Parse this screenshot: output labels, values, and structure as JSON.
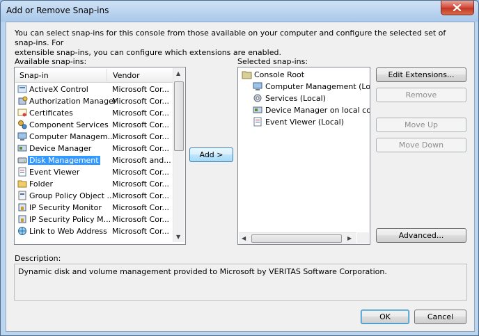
{
  "window": {
    "title": "Add or Remove Snap-ins"
  },
  "intro": {
    "line1": "You can select snap-ins for this console from those available on your computer and configure the selected set of snap-ins. For",
    "line2": "extensible snap-ins, you can configure which extensions are enabled."
  },
  "available": {
    "label": "Available snap-ins:",
    "col_snapin": "Snap-in",
    "col_vendor": "Vendor",
    "rows": [
      {
        "name": "ActiveX Control",
        "vendor": "Microsoft Cor...",
        "icon": "activex-icon"
      },
      {
        "name": "Authorization Manager",
        "vendor": "Microsoft Cor...",
        "icon": "authorization-icon"
      },
      {
        "name": "Certificates",
        "vendor": "Microsoft Cor...",
        "icon": "certificate-icon"
      },
      {
        "name": "Component Services",
        "vendor": "Microsoft Cor...",
        "icon": "component-services-icon"
      },
      {
        "name": "Computer Managem...",
        "vendor": "Microsoft Cor...",
        "icon": "computer-management-icon"
      },
      {
        "name": "Device Manager",
        "vendor": "Microsoft Cor...",
        "icon": "device-manager-icon"
      },
      {
        "name": "Disk Management",
        "vendor": "Microsoft and...",
        "icon": "disk-icon"
      },
      {
        "name": "Event Viewer",
        "vendor": "Microsoft Cor...",
        "icon": "event-viewer-icon"
      },
      {
        "name": "Folder",
        "vendor": "Microsoft Cor...",
        "icon": "folder-icon"
      },
      {
        "name": "Group Policy Object ...",
        "vendor": "Microsoft Cor...",
        "icon": "group-policy-icon"
      },
      {
        "name": "IP Security Monitor",
        "vendor": "Microsoft Cor...",
        "icon": "ip-security-icon"
      },
      {
        "name": "IP Security Policy M...",
        "vendor": "Microsoft Cor...",
        "icon": "ip-security-icon"
      },
      {
        "name": "Link to Web Address",
        "vendor": "Microsoft Cor...",
        "icon": "web-link-icon"
      }
    ],
    "selected_index": 6
  },
  "selected": {
    "label": "Selected snap-ins:",
    "root": "Console Root",
    "children": [
      {
        "name": "Computer Management (Local)",
        "icon": "computer-management-icon"
      },
      {
        "name": "Services (Local)",
        "icon": "services-icon"
      },
      {
        "name": "Device Manager on local compu",
        "icon": "device-manager-icon"
      },
      {
        "name": "Event Viewer (Local)",
        "icon": "event-viewer-icon"
      }
    ]
  },
  "buttons": {
    "add": "Add >",
    "edit_extensions": "Edit Extensions...",
    "remove": "Remove",
    "move_up": "Move Up",
    "move_down": "Move Down",
    "advanced": "Advanced...",
    "ok": "OK",
    "cancel": "Cancel"
  },
  "description": {
    "label": "Description:",
    "text": "Dynamic disk and volume management provided to Microsoft by VERITAS Software Corporation."
  }
}
